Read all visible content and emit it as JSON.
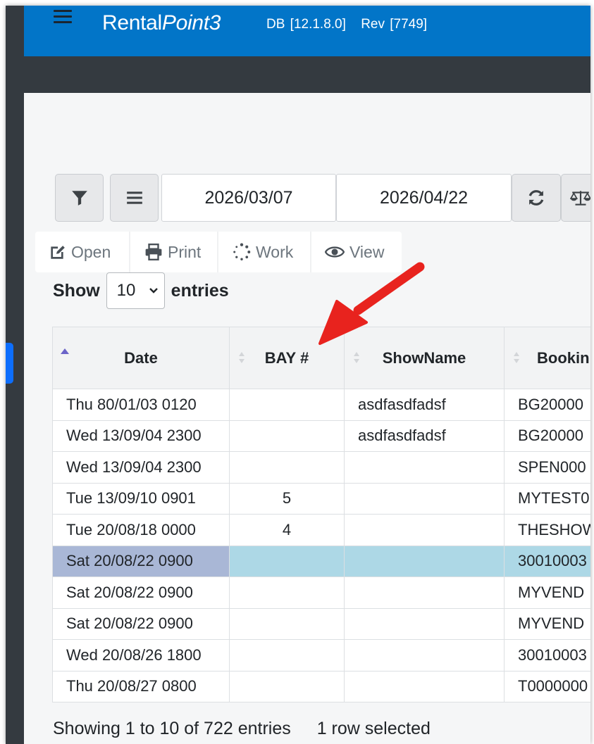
{
  "header": {
    "brand_regular": "Rental",
    "brand_italic": "Point3",
    "db_version": "DB [12.1.8.0]",
    "revision": "Rev [7749]"
  },
  "toolbar": {
    "filter_icon": "filter-icon",
    "menu_icon": "list-icon",
    "start_date": "2026/03/07",
    "end_date": "2026/04/22",
    "refresh_icon": "refresh-icon",
    "balance_icon": "balance-scale-icon"
  },
  "actions": [
    {
      "label": "Open",
      "icon": "edit-icon"
    },
    {
      "label": "Print",
      "icon": "print-icon"
    },
    {
      "label": "Work",
      "icon": "spinner-icon"
    },
    {
      "label": "View",
      "icon": "eye-icon"
    }
  ],
  "length_menu": {
    "show_label": "Show",
    "selected": "10",
    "entries_label": "entries"
  },
  "table": {
    "columns": [
      "Date",
      "BAY #",
      "ShowName",
      "Bookin"
    ],
    "rows": [
      {
        "date": "Thu 80/01/03 0120",
        "bay": "",
        "show": "asdfasdfadsf",
        "booking": "BG20000"
      },
      {
        "date": "Wed 13/09/04 2300",
        "bay": "",
        "show": "asdfasdfadsf",
        "booking": "BG20000"
      },
      {
        "date": "Wed 13/09/04 2300",
        "bay": "",
        "show": "",
        "booking": "SPEN000"
      },
      {
        "date": "Tue 13/09/10 0901",
        "bay": "5",
        "show": "",
        "booking": "MYTEST0"
      },
      {
        "date": "Tue 20/08/18 0000",
        "bay": "4",
        "show": "",
        "booking": "THESHOW"
      },
      {
        "date": "Sat 20/08/22 0900",
        "bay": "",
        "show": "",
        "booking": "30010003"
      },
      {
        "date": "Sat 20/08/22 0900",
        "bay": "",
        "show": "",
        "booking": "MYVEND"
      },
      {
        "date": "Sat 20/08/22 0900",
        "bay": "",
        "show": "",
        "booking": "MYVEND"
      },
      {
        "date": "Wed 20/08/26 1800",
        "bay": "",
        "show": "",
        "booking": "30010003"
      },
      {
        "date": "Thu 20/08/27 0800",
        "bay": "",
        "show": "",
        "booking": "T0000000"
      }
    ]
  },
  "footer": {
    "info": "Showing 1 to 10 of 722 entries",
    "selection": "1 row selected"
  },
  "colors": {
    "header_blue": "#0275c8",
    "dark_bar": "#343a40",
    "selected_row": "#add8e6",
    "annotation_arrow": "#e8231e"
  }
}
